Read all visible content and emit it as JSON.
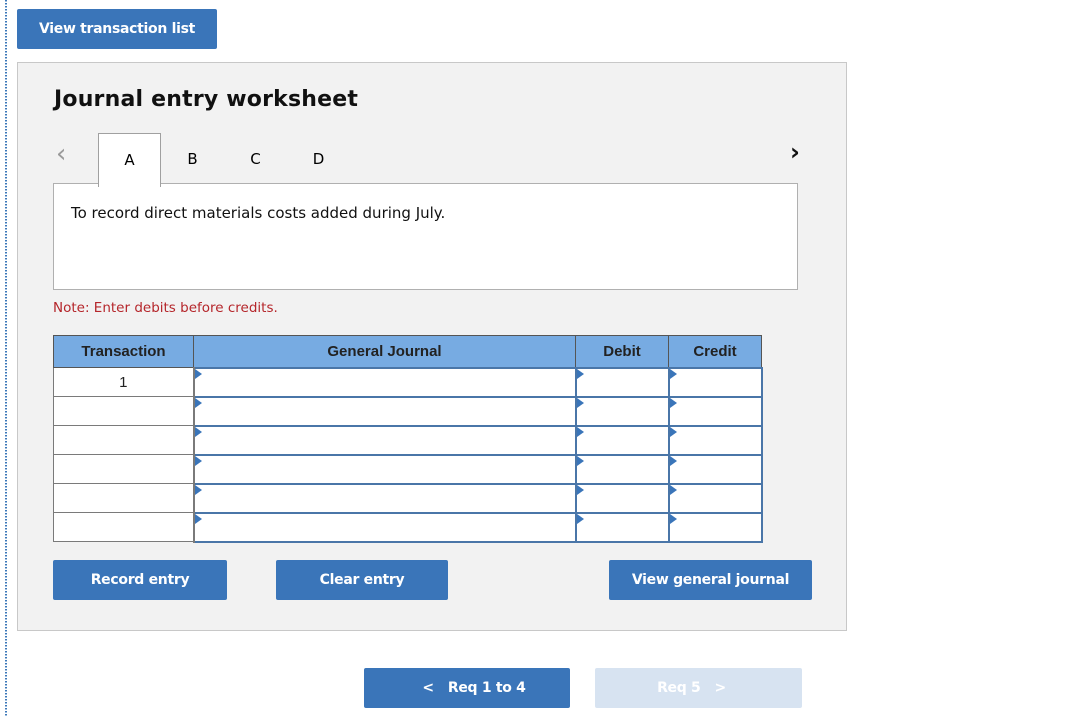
{
  "top_button": {
    "label": "View transaction list"
  },
  "worksheet": {
    "title": "Journal entry worksheet",
    "tabs": [
      {
        "label": "A",
        "active": true
      },
      {
        "label": "B",
        "active": false
      },
      {
        "label": "C",
        "active": false
      },
      {
        "label": "D",
        "active": false
      }
    ],
    "prev_icon": "chevron-left-icon",
    "next_icon": "chevron-right-icon",
    "description": "To record direct materials costs added during July.",
    "note": "Note: Enter debits before credits.",
    "table": {
      "headers": [
        "Transaction",
        "General Journal",
        "Debit",
        "Credit"
      ],
      "rows": [
        {
          "transaction": "1",
          "account": "",
          "debit": "",
          "credit": ""
        },
        {
          "transaction": "",
          "account": "",
          "debit": "",
          "credit": ""
        },
        {
          "transaction": "",
          "account": "",
          "debit": "",
          "credit": ""
        },
        {
          "transaction": "",
          "account": "",
          "debit": "",
          "credit": ""
        },
        {
          "transaction": "",
          "account": "",
          "debit": "",
          "credit": ""
        },
        {
          "transaction": "",
          "account": "",
          "debit": "",
          "credit": ""
        }
      ]
    },
    "buttons": {
      "record": "Record entry",
      "clear": "Clear entry",
      "view_journal": "View general journal"
    }
  },
  "navigation": {
    "prev": {
      "label": "Req 1 to 4",
      "icon": "chevron-left-icon",
      "enabled": true
    },
    "next": {
      "label": "Req 5",
      "icon": "chevron-right-icon",
      "enabled": false
    }
  },
  "colors": {
    "primary_button": "#3a75b9",
    "disabled_button": "#d7e3f1",
    "table_header": "#77abe2",
    "note_text": "#b5262b",
    "panel_bg": "#f2f2f2"
  }
}
